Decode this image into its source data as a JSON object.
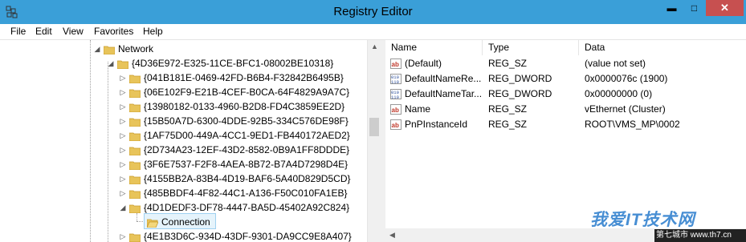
{
  "window": {
    "title": "Registry Editor",
    "close_glyph": "✕",
    "minimize_glyph": "▬",
    "maximize_glyph": "□"
  },
  "menu": [
    "File",
    "Edit",
    "View",
    "Favorites",
    "Help"
  ],
  "tree": {
    "parent": "Network",
    "class_key": "{4D36E972-E325-11CE-BFC1-08002BE10318}",
    "children": [
      "{041B181E-0469-42FD-B6B4-F32842B6495B}",
      "{06E102F9-E21B-4CEF-B0CA-64F4829A9A7C}",
      "{13980182-0133-4960-B2D8-FD4C3859EE2D}",
      "{15B50A7D-6300-4DDE-92B5-334C576DE98F}",
      "{1AF75D00-449A-4CC1-9ED1-FB440172AED2}",
      "{2D734A23-12EF-43D2-8582-0B9A1FF8DDDE}",
      "{3F6E7537-F2F8-4AEA-8B72-B7A4D7298D4E}",
      "{4155BB2A-83B4-4D19-BAF6-5A40D829D5CD}",
      "{485BBDF4-4F82-44C1-A136-F50C010FA1EB}",
      "{4D1DEDF3-DF78-4447-BA5D-45402A92C824}"
    ],
    "selected": "Connection",
    "last_child": "{4E1B3D6C-934D-43DF-9301-DA9CC9E8A407}"
  },
  "list": {
    "headers": [
      "Name",
      "Type",
      "Data"
    ],
    "rows": [
      {
        "icon": "string-value-icon",
        "name": "(Default)",
        "type": "REG_SZ",
        "data": "(value not set)"
      },
      {
        "icon": "binary-value-icon",
        "name": "DefaultNameRe...",
        "type": "REG_DWORD",
        "data": "0x0000076c (1900)"
      },
      {
        "icon": "binary-value-icon",
        "name": "DefaultNameTar...",
        "type": "REG_DWORD",
        "data": "0x00000000 (0)"
      },
      {
        "icon": "string-value-icon",
        "name": "Name",
        "type": "REG_SZ",
        "data": "vEthernet (Cluster)"
      },
      {
        "icon": "string-value-icon",
        "name": "PnPInstanceId",
        "type": "REG_SZ",
        "data": "ROOT\\VMS_MP\\0002"
      }
    ]
  },
  "watermark": {
    "text": "我爱IT技术网",
    "site": "第七城市 www.th7.cn"
  },
  "colors": {
    "titlebar": "#3a9fd8",
    "close": "#c75050",
    "folder": "#e8c45a",
    "selection": "#e5f3fb"
  }
}
